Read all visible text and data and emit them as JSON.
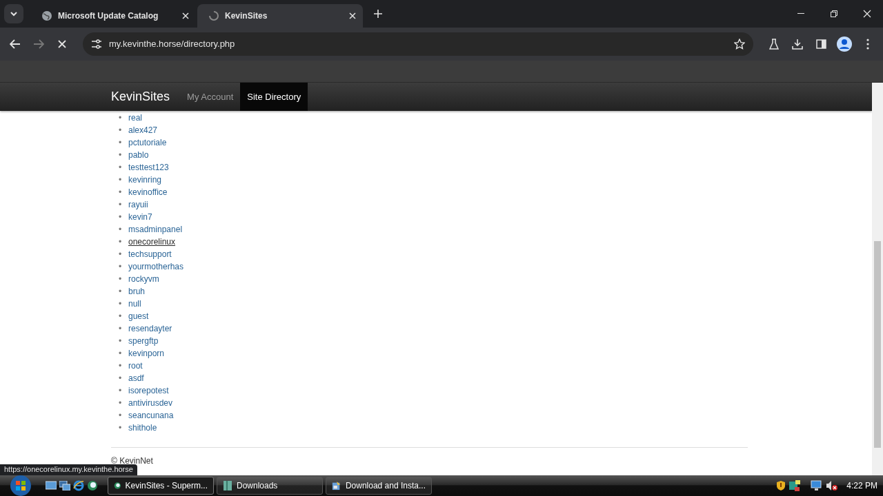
{
  "browser": {
    "loading": true,
    "address": "my.kevinthe.horse/directory.php",
    "tabs": [
      {
        "title": "Microsoft Update Catalog",
        "selected": false,
        "loading": false
      },
      {
        "title": "KevinSites",
        "selected": true,
        "loading": true
      }
    ]
  },
  "site": {
    "brand": "KevinSites",
    "nav": [
      {
        "label": "My Account",
        "selected": false
      },
      {
        "label": "Site Directory",
        "selected": true
      }
    ],
    "sites": [
      {
        "name": "real",
        "hovered": false
      },
      {
        "name": "alex427",
        "hovered": false
      },
      {
        "name": "pctutoriale",
        "hovered": false
      },
      {
        "name": "pablo",
        "hovered": false
      },
      {
        "name": "testtest123",
        "hovered": false
      },
      {
        "name": "kevinring",
        "hovered": false
      },
      {
        "name": "kevinoffice",
        "hovered": false
      },
      {
        "name": "rayuii",
        "hovered": false
      },
      {
        "name": "kevin7",
        "hovered": false
      },
      {
        "name": "msadminpanel",
        "hovered": false
      },
      {
        "name": "onecorelinux",
        "hovered": true
      },
      {
        "name": "techsupport",
        "hovered": false
      },
      {
        "name": "yourmotherhas",
        "hovered": false
      },
      {
        "name": "rockyvm",
        "hovered": false
      },
      {
        "name": "bruh",
        "hovered": false
      },
      {
        "name": "null",
        "hovered": false
      },
      {
        "name": "guest",
        "hovered": false
      },
      {
        "name": "resendayter",
        "hovered": false
      },
      {
        "name": "spergftp",
        "hovered": false
      },
      {
        "name": "kevinporn",
        "hovered": false
      },
      {
        "name": "root",
        "hovered": false
      },
      {
        "name": "asdf",
        "hovered": false
      },
      {
        "name": "isorepotest",
        "hovered": false
      },
      {
        "name": "antivirusdev",
        "hovered": false
      },
      {
        "name": "seancunana",
        "hovered": false
      },
      {
        "name": "shithole",
        "hovered": false
      }
    ],
    "bullet": "•",
    "footer": "© KevinNet"
  },
  "status_url": "https://onecorelinux.my.kevinthe.horse",
  "taskbar": {
    "buttons": [
      {
        "label": "KevinSites - Superm...",
        "selected": true,
        "kind": "browser"
      },
      {
        "label": "Downloads",
        "selected": false,
        "kind": "folder"
      },
      {
        "label": "Download and Insta...",
        "selected": false,
        "kind": "installer"
      }
    ],
    "clock": "4:22 PM"
  }
}
